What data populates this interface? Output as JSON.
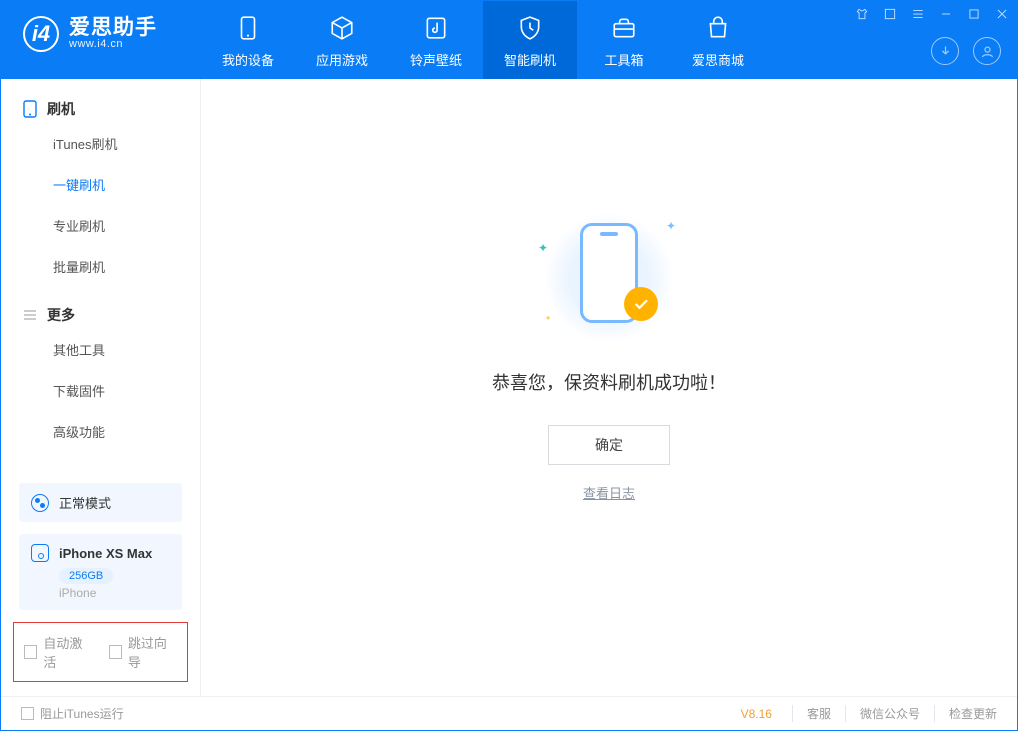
{
  "app": {
    "name_cn": "爱思助手",
    "name_en": "www.i4.cn"
  },
  "nav": {
    "mydevice": "我的设备",
    "apps": "应用游戏",
    "ringtone": "铃声壁纸",
    "flash": "智能刷机",
    "toolbox": "工具箱",
    "store": "爱思商城"
  },
  "sidebar": {
    "sec_flash": "刷机",
    "items_flash": {
      "itunes": "iTunes刷机",
      "oneclick": "一键刷机",
      "pro": "专业刷机",
      "batch": "批量刷机"
    },
    "sec_more": "更多",
    "items_more": {
      "other": "其他工具",
      "firmware": "下载固件",
      "advanced": "高级功能"
    },
    "mode_label": "正常模式",
    "device": {
      "name": "iPhone XS Max",
      "capacity": "256GB",
      "type": "iPhone"
    },
    "opts": {
      "auto_activate": "自动激活",
      "skip_guide": "跳过向导"
    }
  },
  "main": {
    "success_msg": "恭喜您，保资料刷机成功啦！",
    "ok": "确定",
    "view_log": "查看日志"
  },
  "footer": {
    "block_itunes": "阻止iTunes运行",
    "version": "V8.16",
    "support": "客服",
    "wechat": "微信公众号",
    "update": "检查更新"
  }
}
